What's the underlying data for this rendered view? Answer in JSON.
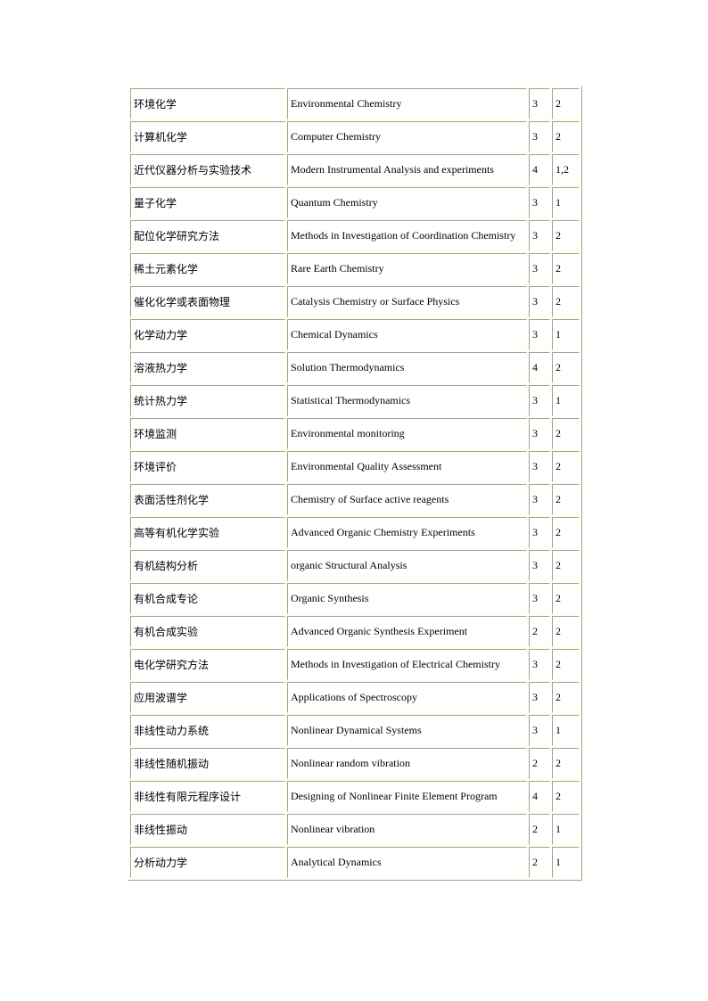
{
  "table": {
    "rows": [
      {
        "cn": "环境化学",
        "en": "Environmental  Chemistry",
        "credit": "3",
        "semester": "2"
      },
      {
        "cn": "计算机化学",
        "en": "Computer Chemistry",
        "credit": "3",
        "semester": "2"
      },
      {
        "cn": "近代仪器分析与实验技术",
        "en": "Modern Instrumental  Analysis and experiments",
        "credit": "4",
        "semester": "1,2"
      },
      {
        "cn": "量子化学",
        "en": "Quantum Chemistry",
        "credit": "3",
        "semester": "1"
      },
      {
        "cn": "配位化学研究方法",
        "en": "Methods in Investigation  of Coordination Chemistry",
        "credit": "3",
        "semester": "2"
      },
      {
        "cn": "稀土元素化学",
        "en": "Rare Earth Chemistry",
        "credit": "3",
        "semester": "2"
      },
      {
        "cn": "催化化学或表面物理",
        "en": "Catalysis Chemistry or Surface Physics",
        "credit": "3",
        "semester": "2"
      },
      {
        "cn": "化学动力学",
        "en": "Chemical  Dynamics",
        "credit": "3",
        "semester": "1"
      },
      {
        "cn": "溶液热力学",
        "en": "Solution  Thermodynamics",
        "credit": "4",
        "semester": "2"
      },
      {
        "cn": "统计热力学",
        "en": "Statistical  Thermodynamics",
        "credit": "3",
        "semester": "1"
      },
      {
        "cn": "环境监测",
        "en": "Environmental  monitoring",
        "credit": "3",
        "semester": "2"
      },
      {
        "cn": "环境评价",
        "en": "Environmental  Quality Assessment",
        "credit": "3",
        "semester": "2"
      },
      {
        "cn": "表面活性剂化学",
        "en": "Chemistry of Surface active reagents",
        "credit": "3",
        "semester": "2"
      },
      {
        "cn": "高等有机化学实验",
        "en": "Advanced Organic Chemistry Experiments",
        "credit": "3",
        "semester": "2"
      },
      {
        "cn": "有机结构分析",
        "en": "organic Structural Analysis",
        "credit": "3",
        "semester": "2"
      },
      {
        "cn": "有机合成专论",
        "en": "Organic Synthesis",
        "credit": "3",
        "semester": "2"
      },
      {
        "cn": "有机合成实验",
        "en": "Advanced Organic Synthesis Experiment",
        "credit": "2",
        "semester": "2"
      },
      {
        "cn": "电化学研究方法",
        "en": "Methods in Investigation  of Electrical  Chemistry",
        "credit": "3",
        "semester": "2"
      },
      {
        "cn": "应用波谱学",
        "en": "Applications of Spectroscopy",
        "credit": "3",
        "semester": "2"
      },
      {
        "cn": "非线性动力系统",
        "en": "Nonlinear Dynamical  Systems",
        "credit": "3",
        "semester": "1"
      },
      {
        "cn": "非线性随机振动",
        "en": "Nonlinear random vibration",
        "credit": "2",
        "semester": "2"
      },
      {
        "cn": "非线性有限元程序设计",
        "en": "Designing of Nonlinear Finite Element  Program",
        "credit": "4",
        "semester": "2"
      },
      {
        "cn": "非线性振动",
        "en": "Nonlinear vibration",
        "credit": "2",
        "semester": "1"
      },
      {
        "cn": "分析动力学",
        "en": "Analytical  Dynamics",
        "credit": "2",
        "semester": "1"
      }
    ]
  }
}
